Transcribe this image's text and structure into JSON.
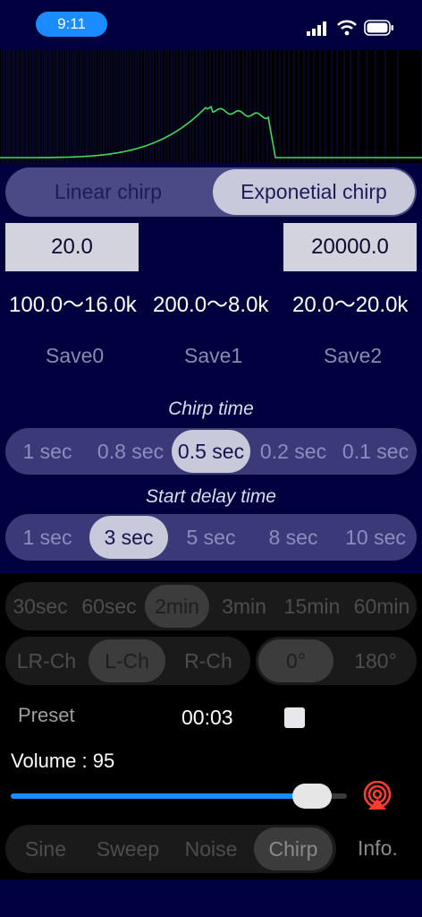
{
  "status": {
    "time": "9:11"
  },
  "chirp_type": {
    "options": [
      "Linear chirp",
      "Exponetial chirp"
    ],
    "selected": 1
  },
  "freq": {
    "start": "20.0",
    "end": "20000.0"
  },
  "presets": {
    "ranges": [
      "100.0〜16.0k",
      "200.0〜8.0k",
      "20.0〜20.0k"
    ],
    "saves": [
      "Save0",
      "Save1",
      "Save2"
    ]
  },
  "chirp_time": {
    "title": "Chirp time",
    "options": [
      "1 sec",
      "0.8 sec",
      "0.5 sec",
      "0.2 sec",
      "0.1 sec"
    ],
    "selected": 2
  },
  "start_delay": {
    "title": "Start delay time",
    "options": [
      "1 sec",
      "3 sec",
      "5 sec",
      "8 sec",
      "10 sec"
    ],
    "selected": 1
  },
  "duration": {
    "options": [
      "30sec",
      "60sec",
      "2min",
      "3min",
      "15min",
      "60min"
    ],
    "selected": 2
  },
  "channel": {
    "options": [
      "LR-Ch",
      "L-Ch",
      "R-Ch"
    ],
    "selected": 1
  },
  "phase": {
    "options": [
      "0°",
      "180°"
    ],
    "selected": 0
  },
  "preset_label": "Preset",
  "timer": "00:03",
  "volume": {
    "label": "Volume : 95",
    "value": 95,
    "max": 100
  },
  "modes": {
    "options": [
      "Sine",
      "Sweep",
      "Noise",
      "Chirp"
    ],
    "selected": 3
  },
  "info_label": "Info.",
  "colors": {
    "accent": "#1a8cff",
    "airplay": "#ff3b30",
    "wave": "#3ddc5a",
    "background": "#00003e"
  }
}
